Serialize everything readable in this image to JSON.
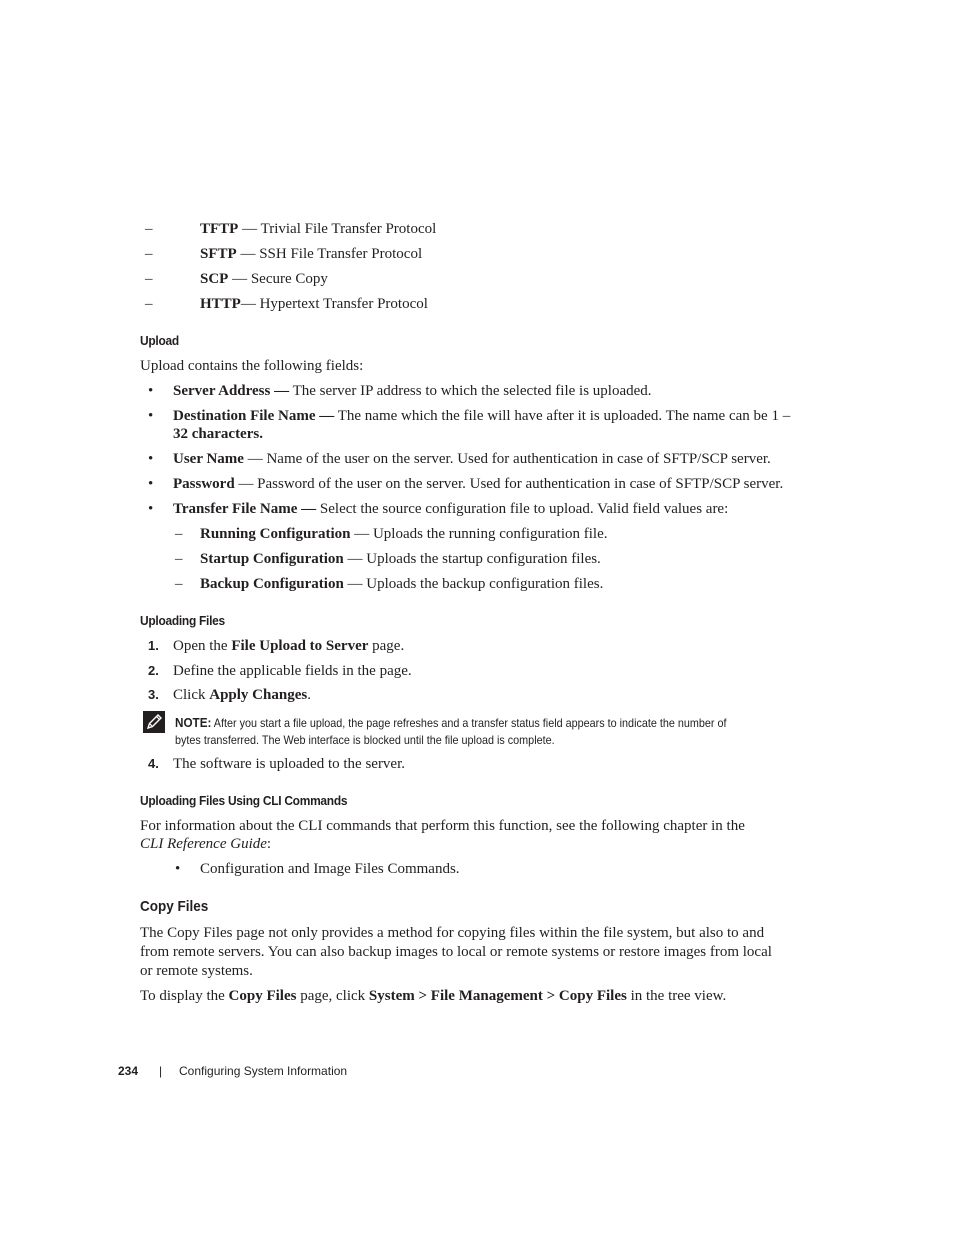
{
  "protocols": [
    {
      "term": "TFTP",
      "sep": " — ",
      "desc": "Trivial File Transfer Protocol"
    },
    {
      "term": "SFTP",
      "sep": " — ",
      "desc": "SSH File Transfer Protocol"
    },
    {
      "term": "SCP",
      "sep": " — ",
      "desc": "Secure Copy"
    },
    {
      "term": "HTTP",
      "sep": "— ",
      "desc": "Hypertext Transfer Protocol"
    }
  ],
  "upload": {
    "heading": "Upload",
    "intro": "Upload contains the following fields:",
    "fields": [
      {
        "term": "Server Address —",
        "desc": " The server IP address to which the selected file is uploaded."
      },
      {
        "term": "Destination File Name —",
        "desc": " The name which the file will have after it is uploaded. The name can be 1 –",
        "cont": "32 characters."
      },
      {
        "term": "User Name",
        "desc": " — Name of the user on the server. Used for authentication in case of SFTP/SCP server."
      },
      {
        "term": "Password",
        "desc": " — Password of the user on the server. Used for authentication in case of SFTP/SCP server."
      },
      {
        "term": "Transfer File Name —",
        "desc": " Select the source configuration file to upload. Valid field values are:"
      }
    ],
    "values": [
      {
        "term": "Running Configuration",
        "desc": " — Uploads the running configuration file."
      },
      {
        "term": "Startup Configuration",
        "desc": " — Uploads the startup configuration files."
      },
      {
        "term": "Backup Configuration",
        "desc": " — Uploads the backup configuration files."
      }
    ]
  },
  "uploading_files": {
    "heading": "Uploading Files",
    "steps": [
      {
        "num": "1.",
        "pre": "Open the ",
        "bold": "File Upload to Server",
        "post": " page."
      },
      {
        "num": "2.",
        "pre": "Define the applicable fields in the page.",
        "bold": "",
        "post": ""
      },
      {
        "num": "3.",
        "pre": "Click ",
        "bold": "Apply Changes",
        "post": "."
      }
    ],
    "note": {
      "label": "NOTE:",
      "line1": " After you start a file upload, the page refreshes and a transfer status field appears to indicate the number of",
      "line2": "bytes transferred. The Web interface is blocked until the file upload is complete."
    },
    "step4": {
      "num": "4.",
      "text": "The software is uploaded to the server."
    }
  },
  "cli": {
    "heading": "Uploading Files Using CLI Commands",
    "line1": "For information about the CLI commands that perform this function, see the following chapter in the",
    "guide": "CLI Reference Guide",
    "guide_post": ":",
    "bullet": "Configuration and Image Files Commands."
  },
  "copy_files": {
    "heading": "Copy Files",
    "para_lines": [
      "The Copy Files page not only provides a method for copying files within the file system, but also to and",
      "from remote servers. You can also backup images to local or remote systems or restore images from local",
      "or remote systems."
    ],
    "display": {
      "pre": "To display the ",
      "b1": "Copy Files",
      "mid": " page, click ",
      "b2": "System > File Management > Copy Files",
      "post": " in the tree view."
    }
  },
  "footer": {
    "page_number": "234",
    "separator": "|",
    "chapter": "Configuring System Information"
  }
}
